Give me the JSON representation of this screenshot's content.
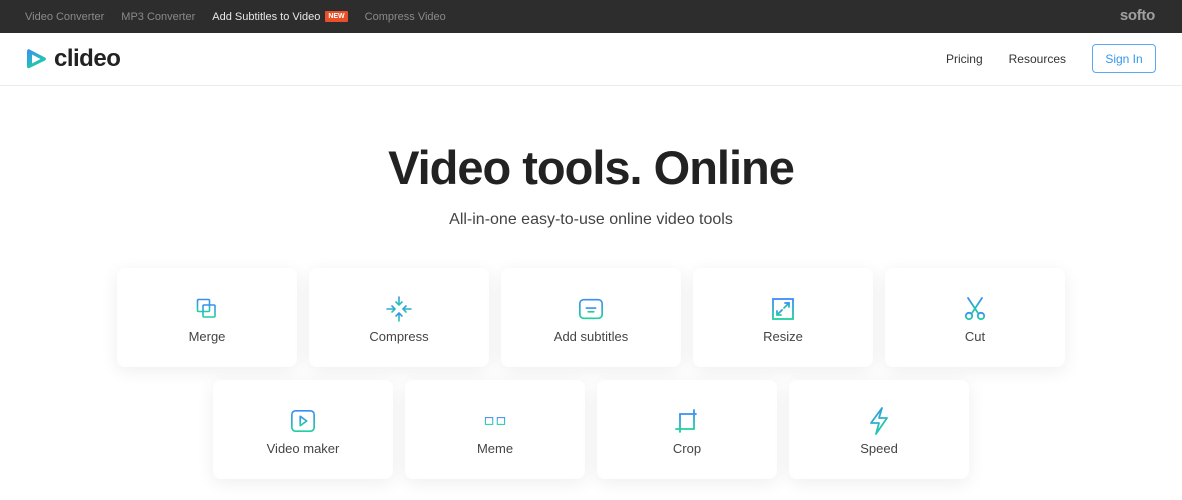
{
  "topbar": {
    "links": [
      {
        "label": "Video Converter",
        "active": false
      },
      {
        "label": "MP3 Converter",
        "active": false
      },
      {
        "label": "Add Subtitles to Video",
        "active": true,
        "badge": "NEW"
      },
      {
        "label": "Compress Video",
        "active": false
      }
    ],
    "brand": "softo"
  },
  "header": {
    "logo_text": "clideo",
    "nav": [
      "Pricing",
      "Resources"
    ],
    "signin_label": "Sign In"
  },
  "hero": {
    "title": "Video tools. Online",
    "subtitle": "All-in-one easy-to-use online video tools"
  },
  "colors": {
    "accent_blue": "#3596ee",
    "gradient_start": "#3a8ef6",
    "gradient_end": "#1fd0a0",
    "badge_red": "#e8502a",
    "topbar_bg": "#2d2d2d"
  },
  "tools": [
    {
      "label": "Merge",
      "icon": "merge-icon"
    },
    {
      "label": "Compress",
      "icon": "compress-icon"
    },
    {
      "label": "Add subtitles",
      "icon": "subtitles-icon"
    },
    {
      "label": "Resize",
      "icon": "resize-icon"
    },
    {
      "label": "Cut",
      "icon": "scissors-icon"
    },
    {
      "label": "Video maker",
      "icon": "play-icon"
    },
    {
      "label": "Meme",
      "icon": "glasses-icon"
    },
    {
      "label": "Crop",
      "icon": "crop-icon"
    },
    {
      "label": "Speed",
      "icon": "lightning-icon"
    }
  ]
}
